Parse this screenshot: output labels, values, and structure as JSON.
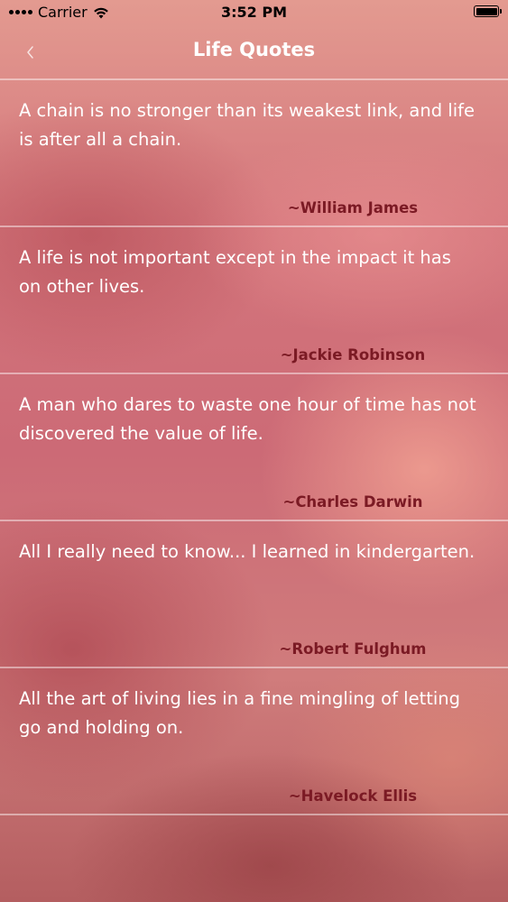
{
  "status_bar": {
    "carrier": "Carrier",
    "time": "3:52 PM"
  },
  "nav": {
    "title": "Life Quotes",
    "back_icon": "chevron-left-icon"
  },
  "colors": {
    "author_text": "#7b1a24",
    "quote_text": "#ffffff"
  },
  "quotes": [
    {
      "text": "A chain is no stronger than its weakest link, and life is after all a chain.",
      "author": "~William James"
    },
    {
      "text": "A life is not important except in the impact it has on other lives.",
      "author": "~Jackie Robinson"
    },
    {
      "text": "A man who dares to waste one hour of time has not discovered the value of life.",
      "author": "~Charles Darwin"
    },
    {
      "text": "All I really need to know... I learned in kindergarten.",
      "author": "~Robert Fulghum"
    },
    {
      "text": "All the art of living lies in a fine mingling of letting go and holding on.",
      "author": "~Havelock Ellis"
    }
  ]
}
